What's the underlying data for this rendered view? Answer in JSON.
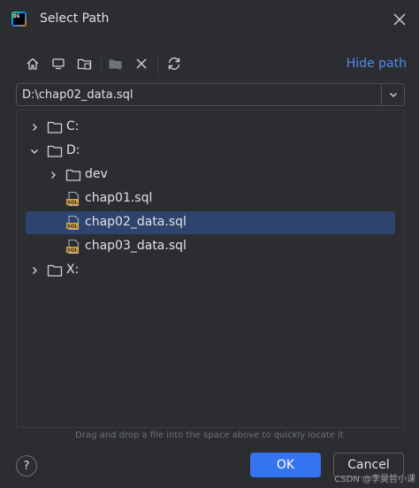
{
  "window": {
    "logo_text": "DG",
    "title": "Select Path"
  },
  "toolbar": {
    "buttons": [
      "home-icon",
      "desktop-icon",
      "project-folder-icon",
      "new-folder-icon",
      "delete-icon",
      "refresh-icon"
    ],
    "hide_path_label": "Hide path"
  },
  "path": {
    "value": "D:\\chap02_data.sql"
  },
  "tree": {
    "items": [
      {
        "label": "C:",
        "type": "folder",
        "expanded": false,
        "depth": 0
      },
      {
        "label": "D:",
        "type": "folder",
        "expanded": true,
        "depth": 0
      },
      {
        "label": "dev",
        "type": "folder",
        "expanded": false,
        "depth": 1
      },
      {
        "label": "chap01.sql",
        "type": "sql-file",
        "depth": 1
      },
      {
        "label": "chap02_data.sql",
        "type": "sql-file",
        "depth": 1,
        "selected": true
      },
      {
        "label": "chap03_data.sql",
        "type": "sql-file",
        "depth": 1
      },
      {
        "label": "X:",
        "type": "folder",
        "expanded": false,
        "depth": 0
      }
    ],
    "sql_badge": "SQL"
  },
  "hint": "Drag and drop a file into the space above to quickly locate it",
  "footer": {
    "help_label": "?",
    "ok_label": "OK",
    "cancel_label": "Cancel"
  },
  "watermark": "CSDN @李昊哲小课",
  "colors": {
    "background": "#2b2d30",
    "selection": "#2e436e",
    "accent": "#3574f0",
    "link": "#548af7"
  }
}
